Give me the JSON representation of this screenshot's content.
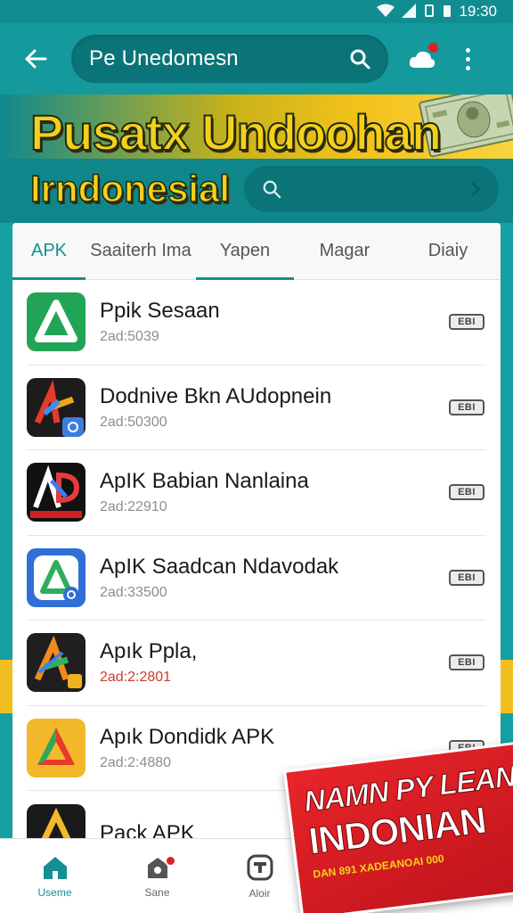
{
  "status_bar": {
    "time": "19:30",
    "icons": [
      "wifi-icon",
      "signal-icon",
      "vibrate-icon",
      "battery-icon"
    ]
  },
  "top_bar": {
    "search_text": "Pe Unedomesn",
    "search_icon": "search-icon",
    "cloud_icon": "cloud-icon"
  },
  "banner": {
    "title": "Pusatx Undoohan",
    "subtitle": "Irndonesial",
    "image": "money-icon"
  },
  "tabs": [
    {
      "label": "APK",
      "active": true
    },
    {
      "label": "Saaiterh Ima",
      "active": false
    },
    {
      "label": "Yapen",
      "active": false
    },
    {
      "label": "Magar",
      "active": false
    },
    {
      "label": "Diaiy",
      "active": false
    }
  ],
  "apps": [
    {
      "name": "Ppik Sesaan",
      "meta": "2ad:5039",
      "badge": "EBI"
    },
    {
      "name": "Dodnive Bkn AUdopnein",
      "meta": "2ad:50300",
      "badge": "EBI"
    },
    {
      "name": "ApIK Babian Nanlaina",
      "meta": "2ad:22910",
      "badge": "EBI"
    },
    {
      "name": "ApIK Saadcan Ndavodak",
      "meta": "2ad:33500",
      "badge": "EBI"
    },
    {
      "name": "Apık Ppla,",
      "meta": "2ad:2:2801",
      "badge": "EBI"
    },
    {
      "name": "Apık Dondidk APK",
      "meta": "2ad:2:4880",
      "badge": "EBI"
    },
    {
      "name": "Pack APK",
      "meta": "",
      "badge": ""
    }
  ],
  "bottom_nav": [
    {
      "label": "Useme",
      "icon": "home-icon",
      "active": true
    },
    {
      "label": "Sane",
      "icon": "store-icon",
      "active": false
    },
    {
      "label": "Aloir",
      "icon": "download-icon",
      "active": false
    }
  ],
  "promo": {
    "line1": "NAMN PY LEAN!",
    "line2": "INDONIAN",
    "line3": "DAN 891 XADEANOAI 000"
  },
  "colors": {
    "teal": "#17a0a4",
    "teal_dark": "#0b7478",
    "yellow": "#f6cf1a",
    "red": "#e02020"
  }
}
